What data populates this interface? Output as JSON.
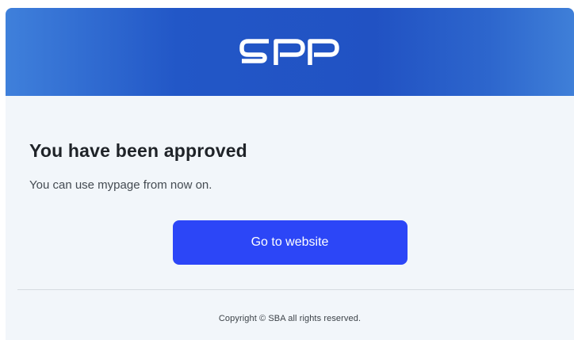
{
  "header": {
    "logo_text": "SPP",
    "logo_icon": "spp-logo",
    "gradient_colors": [
      "#3f80db",
      "#2152c3",
      "#3f7fd8"
    ]
  },
  "main": {
    "title": "You have been approved",
    "message": "You can use mypage from now on.",
    "cta_label": "Go to website",
    "cta_color": "#2c46f7"
  },
  "footer": {
    "copyright": "Copyright © SBA all rights reserved."
  }
}
